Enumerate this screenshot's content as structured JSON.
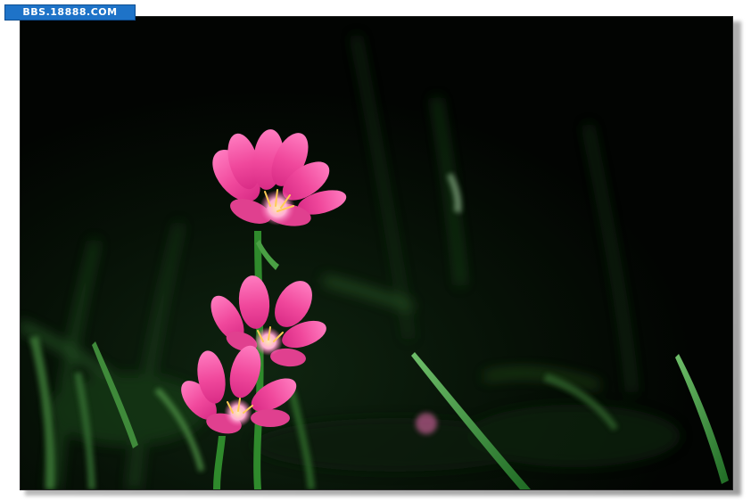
{
  "watermark": {
    "text": "BBS.18888.COM",
    "background_color": "#1e73c8",
    "text_color": "#ffffff"
  },
  "photo": {
    "flower_color": "#f05aa8",
    "stem_color": "#2e8a2e",
    "background_color": "#050905"
  }
}
